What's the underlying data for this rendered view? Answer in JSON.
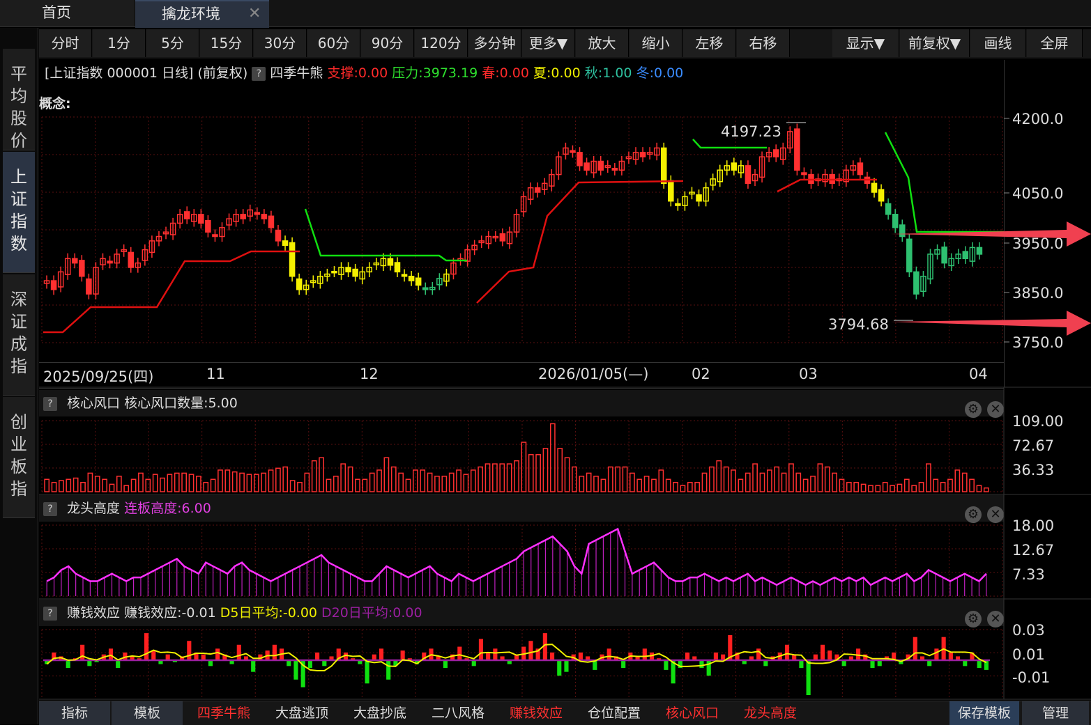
{
  "tabs": {
    "home": "首页",
    "active": "擒龙环境",
    "close": "✕"
  },
  "sidebar": [
    {
      "label": "平均股价"
    },
    {
      "label": "上证指数",
      "active": true
    },
    {
      "label": "深证成指"
    },
    {
      "label": "创业板指"
    }
  ],
  "toolbar": [
    "分时",
    "1分",
    "5分",
    "15分",
    "30分",
    "60分",
    "90分",
    "120分",
    "多分钟",
    "更多▼",
    "放大",
    "缩小",
    "左移",
    "右移",
    "显示▼",
    "前复权▼",
    "画线",
    "全屏"
  ],
  "info": {
    "title": "[上证指数 000001 日线]",
    "fq": "(前复权)",
    "ind": "四季牛熊",
    "support": "支撑:0.00",
    "pressure": "压力:3973.19",
    "spring": "春:0.00",
    "summer": "夏:0.00",
    "autumn": "秋:1.00",
    "winter": "冬:0.00",
    "help": "?"
  },
  "concept": "概念:",
  "main_axis": [
    "4200.0",
    "4050.0",
    "3950.0",
    "3850.0",
    "3750.0"
  ],
  "annotations": {
    "high": "4197.23",
    "low": "3794.68"
  },
  "dates": [
    "2025/09/25(四)",
    "11",
    "12",
    "2026/01/05(—)",
    "02",
    "03",
    "04"
  ],
  "panels": {
    "p1": {
      "help": "?",
      "name": "核心风口",
      "value": "核心风口数量:5.00",
      "axis": [
        "109.00",
        "72.67",
        "36.33"
      ]
    },
    "p2": {
      "help": "?",
      "name": "龙头高度",
      "value": "连板高度:6.00",
      "axis": [
        "18.00",
        "12.67",
        "7.33"
      ]
    },
    "p3": {
      "help": "?",
      "name": "赚钱效应",
      "value": "赚钱效应:-0.01",
      "d5": "D5日平均:-0.00",
      "d20": "D20日平均:0.00",
      "axis": [
        "0.03",
        "0.01",
        "-0.01"
      ]
    }
  },
  "bottom": {
    "left": [
      "指标",
      "模板"
    ],
    "templates": [
      "四季牛熊",
      "大盘逃顶",
      "大盘抄底",
      "二八风格",
      "赚钱效应",
      "仓位配置",
      "核心风口",
      "龙头高度"
    ],
    "right": [
      "保存模板",
      "管理"
    ]
  },
  "chart_data": [
    {
      "type": "candlestick",
      "title": "",
      "ylim": [
        3720,
        4230
      ],
      "annotations": [
        "4197.23",
        "3794.68"
      ],
      "closes": [
        3860,
        3840,
        3880,
        3910,
        3900,
        3870,
        3830,
        3890,
        3910,
        3900,
        3920,
        3930,
        3890,
        3900,
        3930,
        3950,
        3960,
        3970,
        3990,
        4010,
        4000,
        4010,
        3990,
        3970,
        3960,
        3980,
        4000,
        4010,
        4000,
        4020,
        4010,
        4000,
        3980,
        3950,
        3940,
        3870,
        3840,
        3850,
        3860,
        3870,
        3875,
        3880,
        3890,
        3880,
        3870,
        3880,
        3890,
        3900,
        3910,
        3895,
        3880,
        3870,
        3860,
        3850,
        3840,
        3845,
        3865,
        3875,
        3900,
        3910,
        3930,
        3940,
        3950,
        3960,
        3960,
        3950,
        3970,
        4010,
        4050,
        4070,
        4060,
        4080,
        4100,
        4140,
        4160,
        4150,
        4120,
        4110,
        4130,
        4110,
        4120,
        4110,
        4130,
        4140,
        4150,
        4140,
        4150,
        4160,
        4080,
        4040,
        4030,
        4050,
        4060,
        4040,
        4070,
        4090,
        4110,
        4120,
        4110,
        4120,
        4080,
        4100,
        4140,
        4150,
        4140,
        4160,
        4197,
        4110,
        4100,
        4080,
        4090,
        4100,
        4080,
        4090,
        4110,
        4120,
        4100,
        4080,
        4060,
        4040,
        4010,
        3980,
        3960,
        3880,
        3830,
        3870,
        3920,
        3930,
        3900,
        3910,
        3920,
        3910,
        3935,
        3920,
        3890
      ],
      "colors": [
        "red",
        "red",
        "red",
        "red",
        "red",
        "red",
        "red",
        "red",
        "red",
        "red",
        "red",
        "red",
        "red",
        "red",
        "red",
        "red",
        "red",
        "red",
        "red",
        "red",
        "red",
        "red",
        "red",
        "red",
        "red",
        "red",
        "red",
        "red",
        "red",
        "red",
        "red",
        "red",
        "red",
        "red",
        "yellow",
        "yellow",
        "yellow",
        "yellow",
        "yellow",
        "yellow",
        "yellow",
        "yellow",
        "yellow",
        "yellow",
        "yellow",
        "yellow",
        "yellow",
        "yellow",
        "yellow",
        "yellow",
        "yellow",
        "yellow",
        "yellow",
        "yellow",
        "green",
        "green",
        "green",
        "yellow",
        "red",
        "red",
        "red",
        "red",
        "red",
        "red",
        "red",
        "red",
        "red",
        "red",
        "red",
        "red",
        "red",
        "red",
        "red",
        "red",
        "red",
        "red",
        "red",
        "red",
        "red",
        "red",
        "red",
        "red",
        "red",
        "red",
        "red",
        "red",
        "red",
        "red",
        "yellow",
        "yellow",
        "yellow",
        "yellow",
        "yellow",
        "yellow",
        "yellow",
        "yellow",
        "yellow",
        "yellow",
        "yellow",
        "yellow",
        "red",
        "red",
        "red",
        "red",
        "red",
        "red",
        "red",
        "red",
        "red",
        "red",
        "red",
        "red",
        "red",
        "red",
        "red",
        "red",
        "red",
        "red",
        "yellow",
        "yellow",
        "green",
        "green",
        "green",
        "green",
        "green",
        "green",
        "green",
        "green",
        "green",
        "green",
        "green",
        "green",
        "green",
        "green"
      ]
    },
    {
      "type": "bar",
      "title": "",
      "values": [
        20,
        15,
        18,
        20,
        22,
        15,
        30,
        25,
        20,
        12,
        25,
        10,
        20,
        30,
        20,
        28,
        22,
        28,
        30,
        30,
        28,
        25,
        15,
        20,
        35,
        35,
        32,
        30,
        28,
        28,
        30,
        35,
        38,
        40,
        18,
        15,
        30,
        50,
        55,
        20,
        25,
        45,
        40,
        20,
        20,
        30,
        35,
        55,
        40,
        30,
        20,
        35,
        35,
        30,
        25,
        25,
        30,
        35,
        28,
        35,
        40,
        45,
        45,
        45,
        45,
        50,
        80,
        60,
        60,
        70,
        110,
        70,
        55,
        40,
        25,
        30,
        25,
        20,
        40,
        40,
        40,
        30,
        20,
        25,
        20,
        35,
        20,
        15,
        10,
        15,
        15,
        30,
        40,
        50,
        40,
        35,
        20,
        30,
        45,
        30,
        35,
        40,
        30,
        45,
        30,
        20,
        25,
        45,
        40,
        30,
        20,
        15,
        15,
        12,
        10,
        10,
        15,
        10,
        12,
        20,
        10,
        15,
        45,
        20,
        15,
        20,
        35,
        30,
        20,
        10,
        6
      ],
      "ylim": [
        0,
        115
      ]
    },
    {
      "type": "line",
      "title": "",
      "values": [
        4,
        5,
        7,
        8,
        6,
        5,
        4,
        4,
        5,
        6,
        5,
        4,
        5,
        5,
        6,
        7,
        8,
        9,
        10,
        8,
        7,
        6,
        9,
        8,
        7,
        6,
        8,
        9,
        7,
        6,
        5,
        4,
        5,
        6,
        7,
        8,
        9,
        10,
        11,
        9,
        8,
        7,
        6,
        5,
        4,
        4,
        6,
        8,
        7,
        6,
        5,
        6,
        7,
        8,
        6,
        5,
        4,
        6,
        5,
        4,
        5,
        6,
        7,
        8,
        9,
        10,
        12,
        13,
        14,
        15,
        16,
        14,
        12,
        8,
        6,
        14,
        15,
        16,
        17,
        18,
        12,
        6,
        7,
        8,
        9,
        7,
        5,
        4,
        4,
        5,
        5,
        6,
        5,
        4,
        5,
        4,
        5,
        6,
        4,
        5,
        4,
        3,
        4,
        5,
        4,
        3,
        4,
        3,
        4,
        5,
        4,
        5,
        4,
        5,
        3,
        4,
        5,
        4,
        5,
        6,
        4,
        5,
        7,
        6,
        5,
        4,
        5,
        6,
        5,
        4,
        6
      ],
      "ylim": [
        0,
        19
      ]
    },
    {
      "type": "bar",
      "title": "",
      "values": [
        -0.002,
        0.004,
        0.002,
        -0.004,
        0.001,
        0.008,
        -0.003,
        -0.001,
        0.003,
        0.006,
        -0.004,
        0.004,
        0.002,
        0.001,
        0.014,
        0.005,
        -0.002,
        0.003,
        -0.001,
        0.002,
        0.01,
        0.004,
        0.003,
        -0.003,
        0.006,
        0.003,
        -0.002,
        0.008,
        0.002,
        -0.006,
        0.003,
        0.005,
        0.008,
        0.006,
        -0.003,
        -0.01,
        -0.014,
        -0.004,
        0.004,
        -0.003,
        0.002,
        0.006,
        0.004,
        0.001,
        -0.002,
        -0.012,
        0.003,
        0.006,
        -0.01,
        -0.003,
        0.005,
        0.001,
        -0.002,
        0.004,
        0.006,
        0.002,
        -0.004,
        0.003,
        0.007,
        0.001,
        -0.003,
        0.011,
        0.004,
        0.006,
        0.002,
        -0.002,
        0.003,
        0.007,
        0.01,
        0.006,
        0.014,
        0.004,
        -0.008,
        -0.006,
        0.003,
        0.004,
        0.002,
        -0.005,
        0.003,
        0.006,
        0.002,
        -0.004,
        0.004,
        0.002,
        0.006,
        0.004,
        0.001,
        -0.005,
        -0.012,
        -0.004,
        0.004,
        0.002,
        -0.004,
        -0.008,
        0.004,
        0.003,
        0.013,
        0.004,
        -0.002,
        0.002,
        0.006,
        -0.003,
        0.002,
        0.004,
        0.008,
        0.003,
        -0.004,
        -0.018,
        0.003,
        0.008,
        0.005,
        0.003,
        -0.003,
        0.002,
        0.006,
        0.003,
        -0.004,
        -0.003,
        0.002,
        0.004,
        -0.002,
        0.003,
        0.012,
        0.002,
        -0.003,
        0.006,
        0.012,
        0.004,
        0.002,
        -0.003,
        0.004,
        -0.004,
        -0.005
      ],
      "ylim": [
        -0.02,
        0.016
      ]
    }
  ]
}
